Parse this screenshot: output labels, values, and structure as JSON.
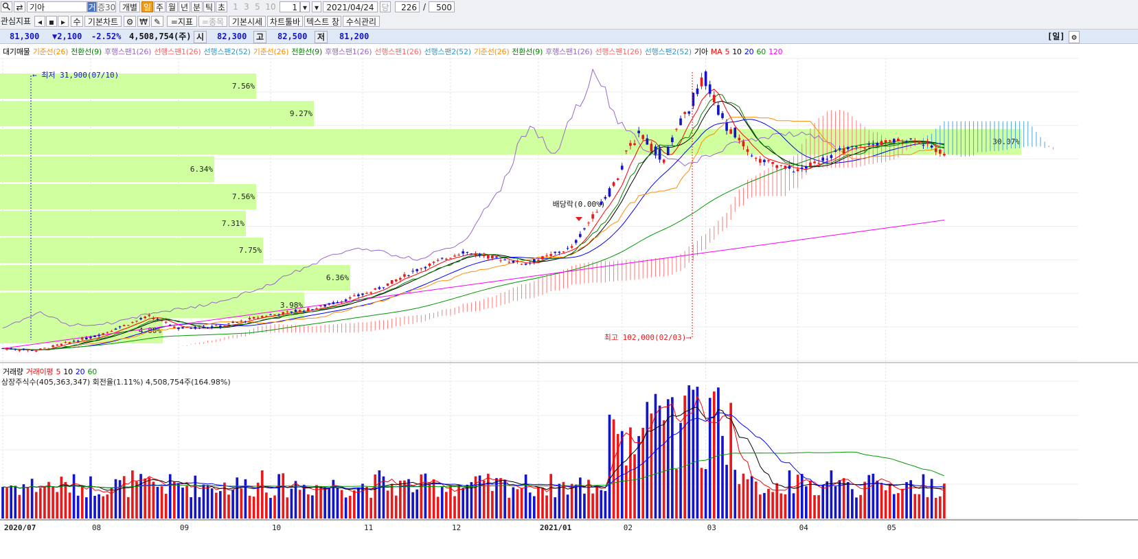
{
  "toolbar": {
    "search_icon": "search-icon",
    "swap_icon": "swap-icon",
    "stock_name": "기아",
    "mode_a": "거",
    "mode_b": "증30",
    "btn_individual": "개별",
    "period_day": "일",
    "period_week": "주",
    "period_month": "월",
    "period_year": "년",
    "period_min": "분",
    "period_tick": "틱",
    "period_sec": "초",
    "num_1": "1",
    "num_3": "3",
    "num_5": "5",
    "num_10": "10",
    "unit_value": "1",
    "date_value": "2021/04/24",
    "date_btn": "당",
    "count_current": "226",
    "count_sep": "/",
    "count_total": "500"
  },
  "toolbar2": {
    "interest_indicator": "관심지표",
    "nav_prev": "◂",
    "nav_mid": "▪",
    "nav_next": "▸",
    "btn_su": "수",
    "basic_chart": "기본차트",
    "indicator": "=지표",
    "stock_item": "=종목",
    "basic_price": "기본시세",
    "chart_toolbar": "차트툴바",
    "text_window": "텍스트 창",
    "formula_manager": "수식관리"
  },
  "infobar": {
    "price": "81,300",
    "change": "▼2,100",
    "change_pct": "-2.52%",
    "volume": "4,508,754(주)",
    "open_label": "시",
    "open": "82,300",
    "high_label": "고",
    "high": "82,500",
    "low_label": "저",
    "low": "81,200",
    "period_tag": "[일]"
  },
  "price_legend": [
    {
      "text": "대기매물",
      "color": "#000000"
    },
    {
      "text": "기준선(26)",
      "color": "#ff8c00"
    },
    {
      "text": "전환선(9)",
      "color": "#008000"
    },
    {
      "text": "후행스팬1(26)",
      "color": "#9966cc"
    },
    {
      "text": "선행스팬1(26)",
      "color": "#ff6666"
    },
    {
      "text": "선행스팬2(52)",
      "color": "#3399cc"
    },
    {
      "text": "기준선(26)",
      "color": "#ff8c00"
    },
    {
      "text": "전환선(9)",
      "color": "#008000"
    },
    {
      "text": "후행스팬1(26)",
      "color": "#9966cc"
    },
    {
      "text": "선행스팬1(26)",
      "color": "#ff6666"
    },
    {
      "text": "선행스팬2(52)",
      "color": "#3399cc"
    },
    {
      "text": "기준선(26)",
      "color": "#ff8c00"
    },
    {
      "text": "전환선(9)",
      "color": "#008000"
    },
    {
      "text": "후행스팬1(26)",
      "color": "#9966cc"
    },
    {
      "text": "선행스팬1(26)",
      "color": "#ff6666"
    },
    {
      "text": "선행스팬2(52)",
      "color": "#3399cc"
    },
    {
      "text": "기아",
      "color": "#000000"
    },
    {
      "text": "MA",
      "color": "#ff0000"
    },
    {
      "text": "5",
      "color": "#ff0000"
    },
    {
      "text": "10",
      "color": "#000000"
    },
    {
      "text": "20",
      "color": "#0000ff"
    },
    {
      "text": "60",
      "color": "#009900"
    },
    {
      "text": "120",
      "color": "#ff00ff"
    }
  ],
  "volume_legend": [
    {
      "text": "거래량",
      "color": "#000000"
    },
    {
      "text": "거래이평",
      "color": "#ff0000"
    },
    {
      "text": "5",
      "color": "#ff0000"
    },
    {
      "text": "10",
      "color": "#000000"
    },
    {
      "text": "20",
      "color": "#0000ff"
    },
    {
      "text": "60",
      "color": "#009900"
    }
  ],
  "listed_shares": "상장주식수(405,363,347) 회전율(1.11%) 4,508,754주(164.98%)",
  "annotations": {
    "low": "최저 31,900(07/10)",
    "high": "최고 102,000(02/03)",
    "dividend": "배당락(0.00%)"
  },
  "chart_data": {
    "type": "candlestick",
    "x_tick_labels": [
      "2020/07",
      "08",
      "09",
      "10",
      "11",
      "12",
      "2021/01",
      "02",
      "03",
      "04",
      "05"
    ],
    "price_range": [
      30000,
      105000
    ],
    "volume_profile_pct": [
      "7.56%",
      "9.27%",
      "",
      "6.34%",
      "7.56%",
      "7.31%",
      "7.75%",
      "6.36%",
      "3.98%",
      "4.80%",
      "30.07%"
    ],
    "ma_periods": [
      5,
      10,
      20,
      60,
      120
    ],
    "volume_ma_periods": [
      5,
      10,
      20,
      60
    ],
    "last_close": 81300,
    "colors": {
      "up": "#e8191a",
      "down": "#1414c8",
      "ma5": "#ff0000",
      "ma10": "#000000",
      "ma20": "#0000ff",
      "ma60": "#009900",
      "ma120": "#ff00ff",
      "profile": "#ccff99"
    }
  }
}
